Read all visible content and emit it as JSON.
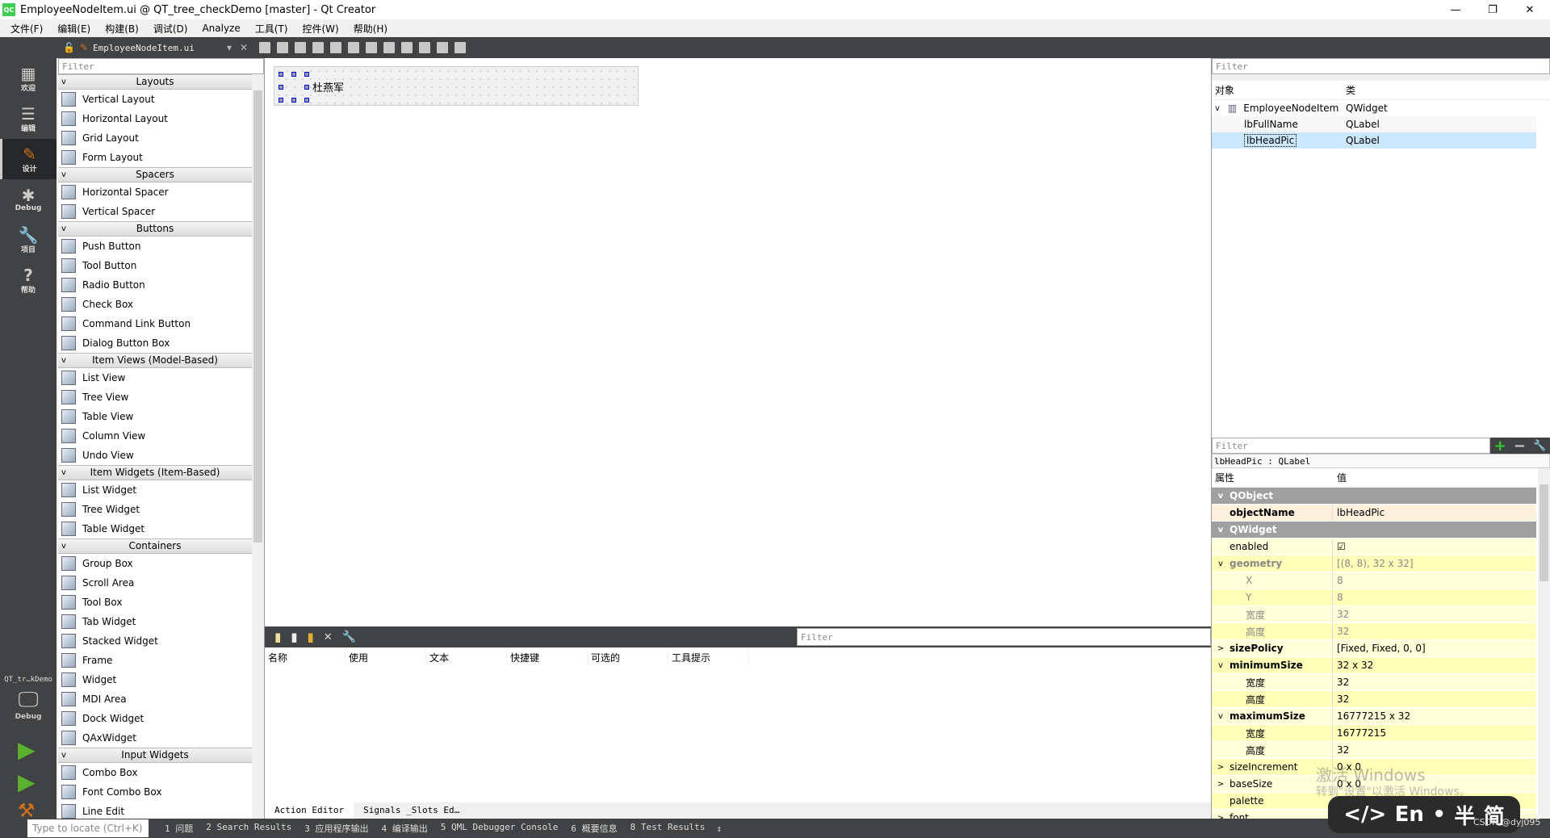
{
  "window": {
    "title": "EmployeeNodeItem.ui @ QT_tree_checkDemo [master] - Qt Creator",
    "logo": "QC",
    "controls": [
      "minimize-icon",
      "restore-icon",
      "close-icon"
    ]
  },
  "menu": [
    "文件(F)",
    "编辑(E)",
    "构建(B)",
    "调试(D)",
    "Analyze",
    "工具(T)",
    "控件(W)",
    "帮助(H)"
  ],
  "toolbar": {
    "file": "EmployeeNodeItem.ui"
  },
  "modes": [
    {
      "label": "欢迎",
      "icon": "grid-icon",
      "glyph": "▦"
    },
    {
      "label": "编辑",
      "icon": "document-icon",
      "glyph": "☰"
    },
    {
      "label": "设计",
      "icon": "pencil-icon",
      "glyph": "✎",
      "active": true
    },
    {
      "label": "Debug",
      "icon": "bug-icon",
      "glyph": "✱"
    },
    {
      "label": "项目",
      "icon": "wrench-icon",
      "glyph": "🔧"
    },
    {
      "label": "帮助",
      "icon": "help-icon",
      "glyph": "?"
    }
  ],
  "kit": {
    "project": "QT_tr…kDemo",
    "mode": "Debug"
  },
  "widgetbox": {
    "filter_placeholder": "Filter",
    "categories": [
      {
        "name": "Layouts",
        "items": [
          "Vertical Layout",
          "Horizontal Layout",
          "Grid Layout",
          "Form Layout"
        ]
      },
      {
        "name": "Spacers",
        "items": [
          "Horizontal Spacer",
          "Vertical Spacer"
        ]
      },
      {
        "name": "Buttons",
        "items": [
          "Push Button",
          "Tool Button",
          "Radio Button",
          "Check Box",
          "Command Link Button",
          "Dialog Button Box"
        ]
      },
      {
        "name": "Item Views (Model-Based)",
        "items": [
          "List View",
          "Tree View",
          "Table View",
          "Column View",
          "Undo View"
        ]
      },
      {
        "name": "Item Widgets (Item-Based)",
        "items": [
          "List Widget",
          "Tree Widget",
          "Table Widget"
        ]
      },
      {
        "name": "Containers",
        "items": [
          "Group Box",
          "Scroll Area",
          "Tool Box",
          "Tab Widget",
          "Stacked Widget",
          "Frame",
          "Widget",
          "MDI Area",
          "Dock Widget",
          "QAxWidget"
        ]
      },
      {
        "name": "Input Widgets",
        "items": [
          "Combo Box",
          "Font Combo Box",
          "Line Edit"
        ]
      }
    ]
  },
  "form": {
    "label_text": "杜燕军"
  },
  "action_editor": {
    "filter_placeholder": "Filter",
    "columns": [
      "名称",
      "使用",
      "文本",
      "快捷键",
      "可选的",
      "工具提示"
    ],
    "tabs": [
      "Action Editor",
      "Signals _Slots Ed…"
    ]
  },
  "object_inspector": {
    "filter_placeholder": "Filter",
    "columns": [
      "对象",
      "类"
    ],
    "rows": [
      {
        "name": "EmployeeNodeItem",
        "class": "QWidget",
        "level": 0
      },
      {
        "name": "lbFullName",
        "class": "QLabel",
        "level": 1
      },
      {
        "name": "lbHeadPic",
        "class": "QLabel",
        "level": 1,
        "selected": true
      }
    ]
  },
  "property_editor": {
    "filter_placeholder": "Filter",
    "object_line": "lbHeadPic : QLabel",
    "columns": [
      "属性",
      "值"
    ],
    "rows": [
      {
        "name": "QObject",
        "type": "group",
        "exp": "v"
      },
      {
        "name": "objectName",
        "value": "lbHeadPic",
        "bold": true,
        "bg": "#fdf0dc"
      },
      {
        "name": "QWidget",
        "type": "group",
        "exp": "v"
      },
      {
        "name": "enabled",
        "value": "☑",
        "bg": "#fefed8"
      },
      {
        "name": "geometry",
        "value": "[(8, 8), 32 x 32]",
        "bold": true,
        "grey": true,
        "exp": "v",
        "bg": "#fefeb8"
      },
      {
        "name": "X",
        "value": "8",
        "sub": true,
        "grey": true,
        "bg": "#fefed8"
      },
      {
        "name": "Y",
        "value": "8",
        "sub": true,
        "grey": true,
        "bg": "#fefeb8"
      },
      {
        "name": "宽度",
        "value": "32",
        "sub": true,
        "grey": true,
        "bg": "#fefed8"
      },
      {
        "name": "高度",
        "value": "32",
        "sub": true,
        "grey": true,
        "bg": "#fefeb8"
      },
      {
        "name": "sizePolicy",
        "value": "[Fixed, Fixed, 0, 0]",
        "bold": true,
        "exp": ">",
        "bg": "#fefed8"
      },
      {
        "name": "minimumSize",
        "value": "32 x 32",
        "bold": true,
        "exp": "v",
        "bg": "#fefeb8"
      },
      {
        "name": "宽度",
        "value": "32",
        "sub": true,
        "bg": "#fefed8"
      },
      {
        "name": "高度",
        "value": "32",
        "sub": true,
        "bg": "#fefeb8"
      },
      {
        "name": "maximumSize",
        "value": "16777215 x 32",
        "bold": true,
        "exp": "v",
        "bg": "#fefed8"
      },
      {
        "name": "宽度",
        "value": "16777215",
        "sub": true,
        "bg": "#fefeb8"
      },
      {
        "name": "高度",
        "value": "32",
        "sub": true,
        "bg": "#fefed8"
      },
      {
        "name": "sizeIncrement",
        "value": "0 x 0",
        "exp": ">",
        "bg": "#fefeb8"
      },
      {
        "name": "baseSize",
        "value": "0 x 0",
        "exp": ">",
        "bg": "#fefed8"
      },
      {
        "name": "palette",
        "value": "",
        "bg": "#fefeb8"
      },
      {
        "name": "font",
        "value": "",
        "exp": ">",
        "bg": "#fefed8"
      }
    ]
  },
  "statusbar": {
    "locate_placeholder": "Type to locate (Ctrl+K)",
    "outputs": [
      "1 问题",
      "2 Search Results",
      "3 应用程序输出",
      "4 编译输出",
      "5 QML Debugger Console",
      "6 概要信息",
      "8 Test Results"
    ]
  },
  "overlay": {
    "watermark_line1": "激活 Windows",
    "watermark_line2": "转到\"设置\"以激活 Windows。",
    "ime": [
      "</>",
      "En",
      "•",
      "半",
      "简"
    ],
    "credit": "CSDN @dyj095"
  },
  "colors": {
    "dark_chrome": "#404244",
    "accent_orange": "#d0701a",
    "selection": "#cce8ff",
    "group_header": "#a0a0a0"
  }
}
